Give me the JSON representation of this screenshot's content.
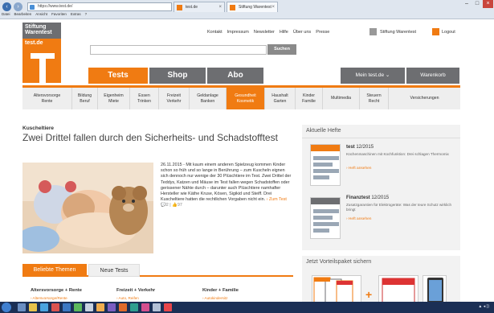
{
  "browser": {
    "address": "https://www.test.de/",
    "tabs": [
      {
        "label": "test.de"
      },
      {
        "label": "Stiftung Warentest"
      }
    ],
    "menu": [
      "Datei",
      "Bearbeiten",
      "Ansicht",
      "Favoriten",
      "Extras",
      "?"
    ]
  },
  "logo": {
    "name_line1": "Stiftung",
    "name_line2": "Warentest",
    "url": "test.de"
  },
  "toplinks": [
    "Kontakt",
    "Impressum",
    "Newsletter",
    "Hilfe",
    "Über uns",
    "Presse"
  ],
  "user": {
    "name": "Stiftung Warentest",
    "logout": "Logout"
  },
  "search": {
    "button": "Suchen"
  },
  "mainnav": {
    "tests": "Tests",
    "shop": "Shop",
    "abo": "Abo",
    "mein": "Mein test.de ⌄",
    "warenkorb": "Warenkorb"
  },
  "subnav": [
    {
      "l1": "Altersvorsorge",
      "l2": "Rente"
    },
    {
      "l1": "Bildung",
      "l2": "Beruf"
    },
    {
      "l1": "Eigenheim",
      "l2": "Miete"
    },
    {
      "l1": "Essen",
      "l2": "Trinken"
    },
    {
      "l1": "Freizeit",
      "l2": "Verkehr"
    },
    {
      "l1": "Geldanlage",
      "l2": "Banken"
    },
    {
      "l1": "Gesundheit",
      "l2": "Kosmetik"
    },
    {
      "l1": "Haushalt",
      "l2": "Garten"
    },
    {
      "l1": "Kinder",
      "l2": "Familie"
    },
    {
      "l1": "Multimedia",
      "l2": ""
    },
    {
      "l1": "Steuern",
      "l2": "Recht"
    },
    {
      "l1": "Versicherungen",
      "l2": ""
    }
  ],
  "article": {
    "kicker": "Kuscheltiere",
    "headline": "Zwei Drittel fallen durch den Sicherheits- und Schad­stofftest",
    "text": "26.11.2015 - Mit kaum einem anderen Spielzeug kommen Kinder schon so früh und so lange in Berührung – zum Kuscheln eignen sich dennoch nur wenige der 30 Plüschtiere im Test. Zwei Drittel der Teddys, Katzen und Mäuse im Test fallen wegen Schadstoffen oder gerissener Nähte durch – darunter auch Plüschtiere namhafter Hersteller wie Käthe Kruse, Kösen, Sigikid und Steiff. Drei Kuscheltiere hatten die rechtlichen Vorgaben nicht ein.",
    "more": "› Zum Test",
    "meta": "💬2 | 👍97"
  },
  "themes": {
    "tab_active": "Beliebte Themen",
    "tab_other": "Neue Tests",
    "cols": [
      {
        "title": "Altersvorsorge + Rente",
        "sub": "› Altersvorsorge/Rente"
      },
      {
        "title": "Freizeit + Verkehr",
        "sub": "› Auto, Reifen"
      },
      {
        "title": "Kinder + Familie",
        "sub": "› Autokindersitz"
      }
    ]
  },
  "sidebar": {
    "title": "Aktuelle Hefte",
    "issues": [
      {
        "name": "test",
        "issue": "12/2015",
        "desc": "Küchenmaschinen mit Kochfunktion: Drei schlagen Thermomix",
        "more": "› Heft ansehen"
      },
      {
        "name": "Finanztest",
        "issue": "12/2015",
        "desc": "Zusatzgarantien für Elektrogeräte: Was der teure Schutz wirklich bringt",
        "more": "› Heft ansehen"
      }
    ],
    "promo_title": "Jetzt Vorteilspaket sichern",
    "plus": "+"
  },
  "taskbar": {
    "tray": "▲ ◂ ))"
  }
}
